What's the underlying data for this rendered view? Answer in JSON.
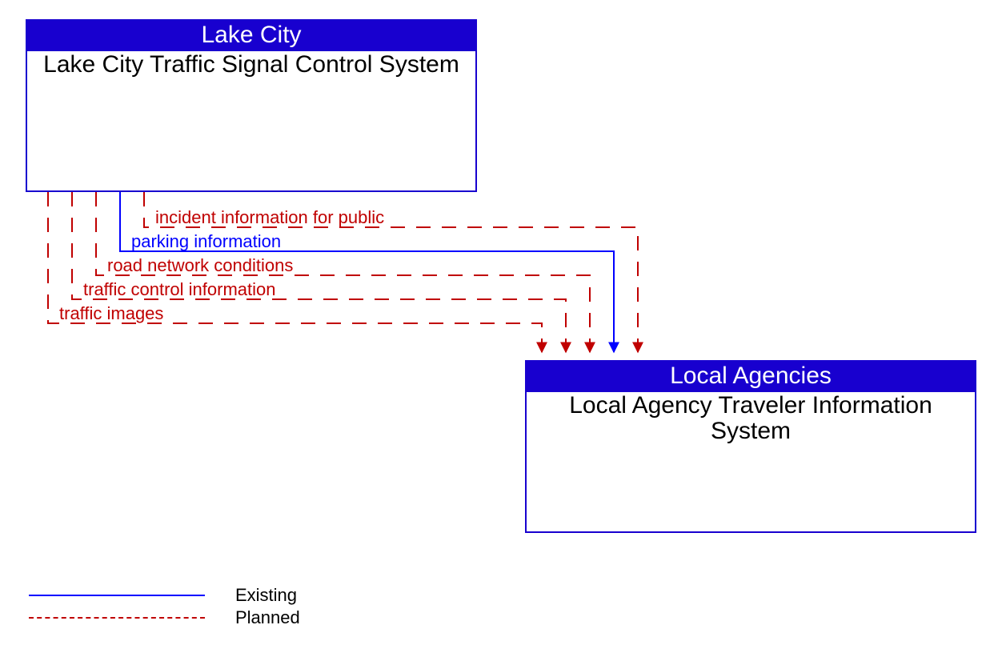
{
  "source_box": {
    "owner": "Lake City",
    "name": "Lake City Traffic Signal Control System"
  },
  "dest_box": {
    "owner": "Local Agencies",
    "name": "Local Agency Traveler Information System"
  },
  "flows": [
    {
      "label": "incident information for public",
      "status": "planned"
    },
    {
      "label": "parking information",
      "status": "existing"
    },
    {
      "label": "road network conditions",
      "status": "planned"
    },
    {
      "label": "traffic control information",
      "status": "planned"
    },
    {
      "label": "traffic images",
      "status": "planned"
    }
  ],
  "legend": {
    "existing_label": "Existing",
    "planned_label": "Planned"
  },
  "colors": {
    "header_bg": "#1800cf",
    "existing": "#0000ff",
    "planned": "#c00000"
  }
}
